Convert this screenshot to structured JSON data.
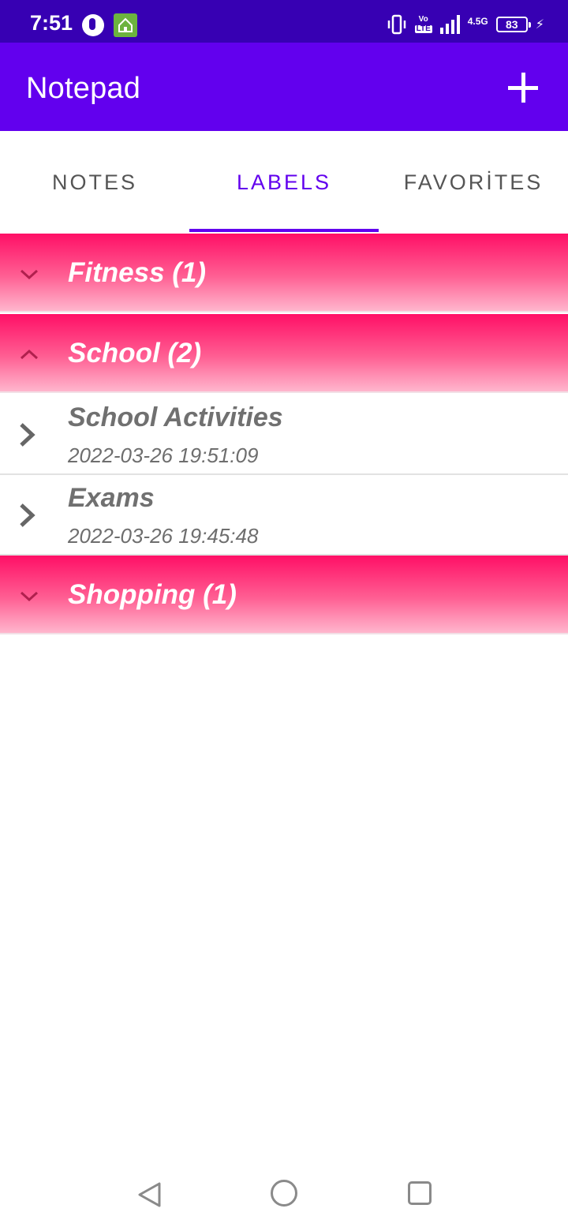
{
  "status_bar": {
    "time": "7:51",
    "network_label_top": "Vo",
    "network_label_bottom": "LTE",
    "network_type": "4.5G",
    "battery": "83"
  },
  "app_bar": {
    "title": "Notepad",
    "add_icon": "plus-icon"
  },
  "tabs": [
    {
      "label": "NOTES",
      "active": false
    },
    {
      "label": "LABELS",
      "active": true
    },
    {
      "label": "FAVORİTES",
      "active": false
    }
  ],
  "groups": [
    {
      "label": "Fitness (1)",
      "expanded": false,
      "icon": "chevron-down-icon"
    },
    {
      "label": "School (2)",
      "expanded": true,
      "icon": "chevron-up-icon",
      "notes": [
        {
          "title": "School Activities",
          "date": "2022-03-26 19:51:09",
          "icon": "chevron-right-icon"
        },
        {
          "title": "Exams",
          "date": "2022-03-26 19:45:48",
          "icon": "chevron-right-icon"
        }
      ]
    },
    {
      "label": "Shopping (1)",
      "expanded": false,
      "icon": "chevron-down-icon"
    }
  ],
  "colors": {
    "status_bar": "#3700b3",
    "primary": "#6200ee",
    "group_gradient_top": "#ff0f66",
    "group_gradient_bottom": "#ffb6cd"
  },
  "nav": {
    "back_icon": "back-triangle-icon",
    "home_icon": "home-circle-icon",
    "recents_icon": "recents-square-icon"
  }
}
